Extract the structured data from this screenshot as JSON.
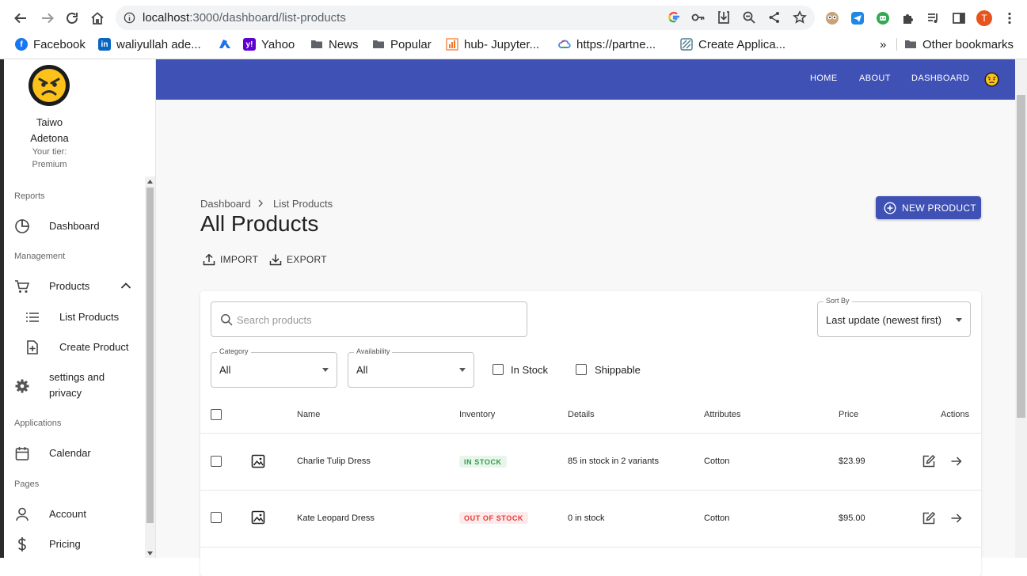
{
  "browser": {
    "url_host": "localhost",
    "url_path": ":3000/dashboard/list-products",
    "profile_initial": "T",
    "bookmarks": [
      {
        "label": "Facebook",
        "color": "#1877f2",
        "glyph": "f"
      },
      {
        "label": "waliyullah ade...",
        "color": "#0a66c2",
        "glyph": "in"
      },
      {
        "label": "",
        "color": "#1a73e8",
        "glyph": "A"
      },
      {
        "label": "Yahoo",
        "color": "#5f01d1",
        "glyph": "y!"
      },
      {
        "label": "News",
        "color": "#5f6368",
        "glyph": "folder"
      },
      {
        "label": "Popular",
        "color": "#5f6368",
        "glyph": "folder"
      },
      {
        "label": "hub- Jupyter...",
        "color": "#f37626",
        "glyph": "bar"
      },
      {
        "label": "https://partne...",
        "color": "#4285f4",
        "glyph": "cloud"
      },
      {
        "label": "Create Applica...",
        "color": "#4a7a8c",
        "glyph": "x"
      }
    ],
    "overflow": "»",
    "other_bookmarks": "Other bookmarks"
  },
  "user": {
    "first_name": "Taiwo",
    "last_name": "Adetona",
    "tier_label": "Your tier:",
    "tier": "Premium"
  },
  "sidebar": {
    "reports": "Reports",
    "dashboard": "Dashboard",
    "management": "Management",
    "products": "Products",
    "list_products": "List Products",
    "create_product": "Create Product",
    "settings_line1": "settings and",
    "settings_line2": "privacy",
    "applications": "Applications",
    "calendar": "Calendar",
    "pages": "Pages",
    "account": "Account",
    "pricing": "Pricing"
  },
  "topnav": {
    "home": "HOME",
    "about": "ABOUT",
    "dashboard": "DASHBOARD"
  },
  "page": {
    "breadcrumb_root": "Dashboard",
    "breadcrumb_current": "List Products",
    "title": "All Products",
    "import": "IMPORT",
    "export": "EXPORT",
    "new_product": "NEW PRODUCT"
  },
  "filters": {
    "search_placeholder": "Search products",
    "sort_label": "Sort By",
    "sort_value": "Last update (newest first)",
    "category_label": "Category",
    "category_value": "All",
    "availability_label": "Availability",
    "availability_value": "All",
    "in_stock": "In Stock",
    "shippable": "Shippable"
  },
  "table": {
    "headers": {
      "name": "Name",
      "inventory": "Inventory",
      "details": "Details",
      "attributes": "Attributes",
      "price": "Price",
      "actions": "Actions"
    },
    "rows": [
      {
        "name": "Charlie Tulip Dress",
        "inventory": "IN STOCK",
        "details": "85 in stock in 2 variants",
        "attributes": "Cotton",
        "price": "$23.99"
      },
      {
        "name": "Kate Leopard Dress",
        "inventory": "OUT OF STOCK",
        "details": "0 in stock",
        "attributes": "Cotton",
        "price": "$95.00"
      }
    ]
  },
  "colors": {
    "primary": "#3f51b5",
    "in_stock_text": "#2e9e48",
    "in_stock_bg": "#e8f5ea",
    "out_stock_text": "#e53935",
    "out_stock_bg": "#fdeaea"
  }
}
